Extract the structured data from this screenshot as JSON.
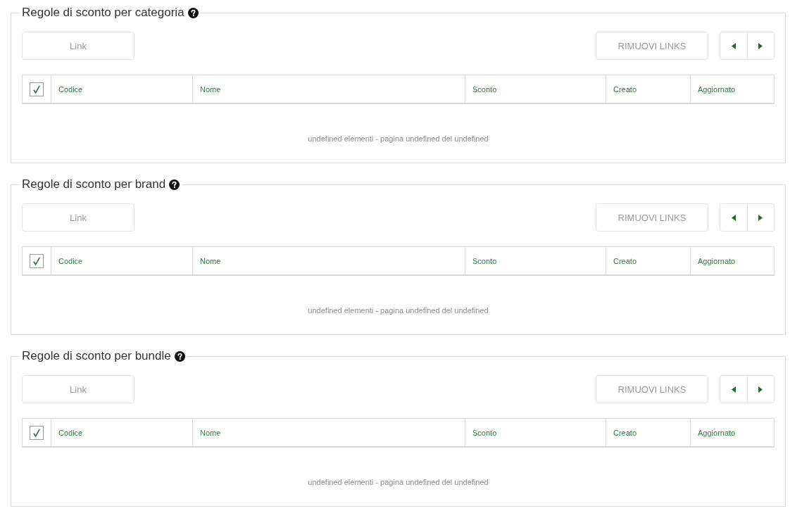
{
  "sections": [
    {
      "title": "Regole di sconto per categoria",
      "link_button": "Link",
      "remove_button": "RIMUOVI LINKS",
      "table": {
        "checkbox": {
          "checked": true
        },
        "columns": [
          "Codice",
          "Nome",
          "Sconto",
          "Creato",
          "Aggiornato"
        ]
      },
      "footer": "undefined elementi - pagina undefined del undefined"
    },
    {
      "title": "Regole di sconto per brand",
      "link_button": "Link",
      "remove_button": "RIMUOVI LINKS",
      "table": {
        "checkbox": {
          "checked": true
        },
        "columns": [
          "Codice",
          "Nome",
          "Sconto",
          "Creato",
          "Aggiornato"
        ]
      },
      "footer": "undefined elementi - pagina undefined del undefined"
    },
    {
      "title": "Regole di sconto per bundle",
      "link_button": "Link",
      "remove_button": "RIMUOVI LINKS",
      "table": {
        "checkbox": {
          "checked": true
        },
        "columns": [
          "Codice",
          "Nome",
          "Sconto",
          "Creato",
          "Aggiornato"
        ]
      },
      "footer": "undefined elementi - pagina undefined del undefined"
    }
  ]
}
